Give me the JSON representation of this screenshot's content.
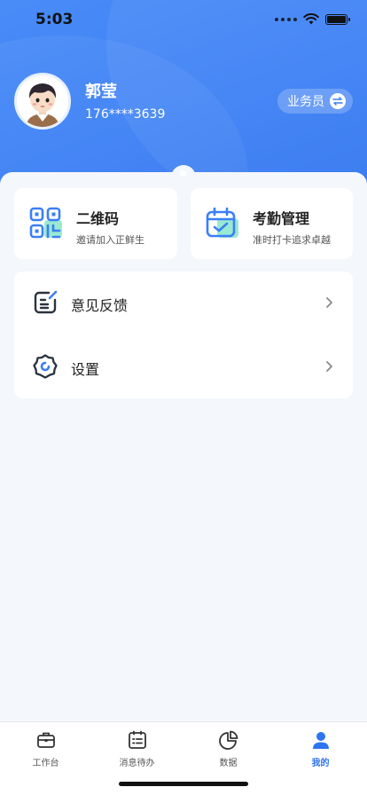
{
  "status": {
    "time": "5:03"
  },
  "profile": {
    "name": "郭莹",
    "phone": "176****3639",
    "role": "业务员"
  },
  "cards": [
    {
      "title": "二维码",
      "subtitle": "邀请加入正鲜生"
    },
    {
      "title": "考勤管理",
      "subtitle": "准时打卡追求卓越"
    }
  ],
  "menu": [
    {
      "label": "意见反馈"
    },
    {
      "label": "设置"
    }
  ],
  "tabs": [
    {
      "label": "工作台",
      "icon": "briefcase-icon"
    },
    {
      "label": "消息待办",
      "icon": "todo-list-icon"
    },
    {
      "label": "数据",
      "icon": "pie-chart-icon"
    },
    {
      "label": "我的",
      "icon": "user-icon",
      "active": true
    }
  ],
  "colors": {
    "accent": "#2f74ef",
    "header": "#3b7ff5",
    "background": "#f4f7fc"
  }
}
